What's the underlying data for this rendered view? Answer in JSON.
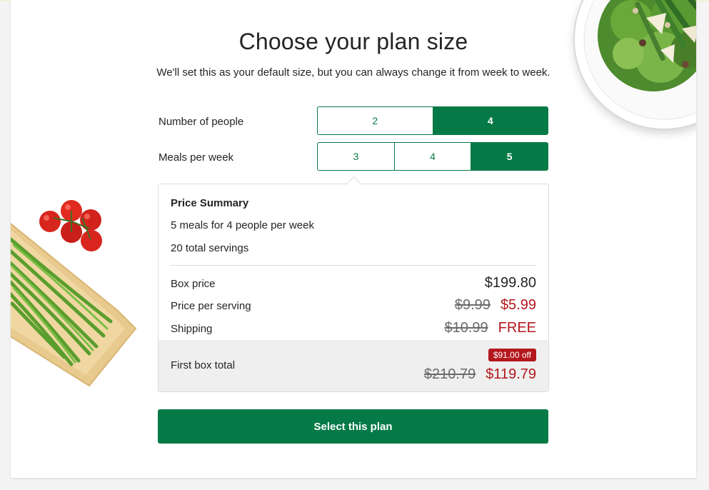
{
  "header": {
    "title": "Choose your plan size",
    "subtitle": "We'll set this as your default size, but you can always change it from week to week."
  },
  "people": {
    "label": "Number of people",
    "options": [
      "2",
      "4"
    ],
    "selected": "4"
  },
  "meals": {
    "label": "Meals per week",
    "options": [
      "3",
      "4",
      "5"
    ],
    "selected": "5"
  },
  "summary": {
    "title": "Price Summary",
    "line1": "5 meals for 4 people per week",
    "line2": "20 total servings",
    "box_price": {
      "label": "Box price",
      "value": "$199.80"
    },
    "per_serving": {
      "label": "Price per serving",
      "old": "$9.99",
      "new": "$5.99"
    },
    "shipping": {
      "label": "Shipping",
      "old": "$10.99",
      "new": "FREE"
    },
    "first_box": {
      "label": "First box total",
      "badge": "$91.00 off",
      "old": "$210.79",
      "new": "$119.79"
    }
  },
  "cta": {
    "label": "Select this plan"
  },
  "colors": {
    "brand_green": "#067a46",
    "sale_red": "#b3181d"
  },
  "icons": [
    "salad-plate-image",
    "green-beans-tomatoes-image"
  ]
}
